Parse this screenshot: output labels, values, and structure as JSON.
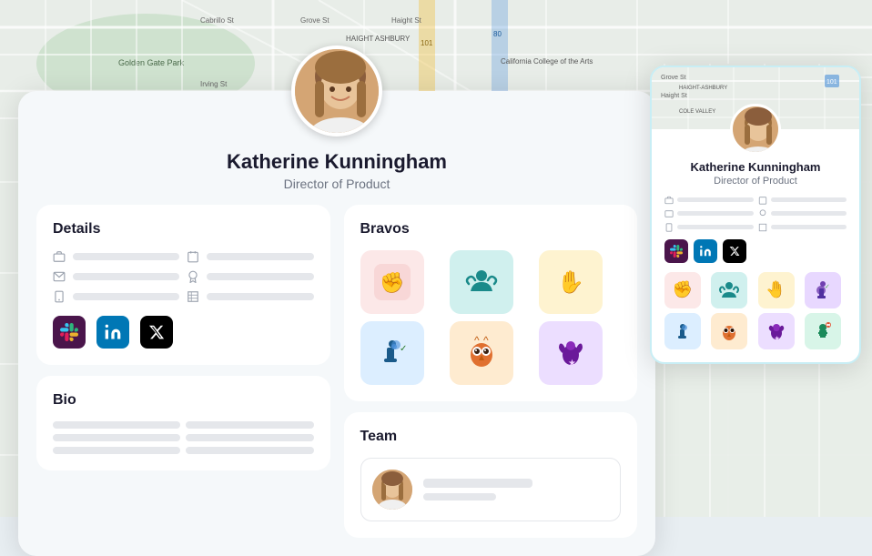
{
  "profile": {
    "name": "Katherine Kunningham",
    "name_short": "Katherine",
    "title": "Director of Product",
    "section_details": "Details",
    "section_bio": "Bio",
    "section_bravos": "Bravos",
    "section_team": "Team"
  },
  "social": {
    "slack_label": "Slack",
    "linkedin_label": "LinkedIn",
    "twitter_label": "X"
  },
  "bravos": [
    {
      "emoji": "✊",
      "color": "bravo-pink",
      "label": "Fist bump"
    },
    {
      "emoji": "🫂",
      "color": "bravo-teal",
      "label": "Hug"
    },
    {
      "emoji": "🤚",
      "color": "bravo-yellow",
      "label": "High five"
    },
    {
      "emoji": "♟️",
      "color": "bravo-blue",
      "label": "Chess"
    },
    {
      "emoji": "🦉",
      "color": "bravo-orange",
      "label": "Owl"
    },
    {
      "emoji": "🦇",
      "color": "bravo-purple",
      "label": "Bat"
    }
  ],
  "colors": {
    "accent": "#0ea5e9",
    "card_bg": "#f5f8fa",
    "border": "#e0f0f5"
  }
}
